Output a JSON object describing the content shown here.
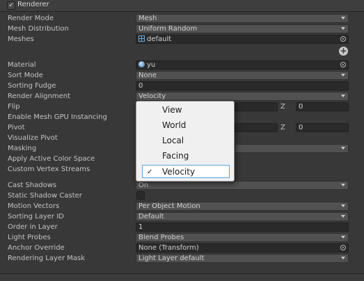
{
  "header": {
    "title": "Renderer",
    "enabled": true
  },
  "rows": {
    "render_mode": {
      "label": "Render Mode",
      "value": "Mesh"
    },
    "mesh_distribution": {
      "label": "Mesh Distribution",
      "value": "Uniform Random"
    },
    "meshes": {
      "label": "Meshes",
      "value": "default",
      "icon": "mesh-icon"
    },
    "material": {
      "label": "Material",
      "value": "yu",
      "icon": "material-icon"
    },
    "sort_mode": {
      "label": "Sort Mode",
      "value": "None"
    },
    "sorting_fudge": {
      "label": "Sorting Fudge",
      "value": "0"
    },
    "render_alignment": {
      "label": "Render Alignment",
      "value": "Velocity"
    },
    "flip": {
      "label": "Flip",
      "z_label": "Z",
      "z_value": "0"
    },
    "enable_mesh_gpu": {
      "label": "Enable Mesh GPU Instancing"
    },
    "pivot": {
      "label": "Pivot",
      "z_label": "Z",
      "z_value": "0"
    },
    "visualize_pivot": {
      "label": "Visualize Pivot"
    },
    "masking": {
      "label": "Masking"
    },
    "apply_active_color": {
      "label": "Apply Active Color Space"
    },
    "custom_vertex": {
      "label": "Custom Vertex Streams"
    },
    "cast_shadows": {
      "label": "Cast Shadows",
      "value": "On"
    },
    "static_shadow": {
      "label": "Static Shadow Caster"
    },
    "motion_vectors": {
      "label": "Motion Vectors",
      "value": "Per Object Motion"
    },
    "sorting_layer": {
      "label": "Sorting Layer ID",
      "value": "Default"
    },
    "order_in_layer": {
      "label": "Order in Layer",
      "value": "1"
    },
    "light_probes": {
      "label": "Light Probes",
      "value": "Blend Probes"
    },
    "anchor_override": {
      "label": "Anchor Override",
      "value": "None (Transform)"
    },
    "rendering_layer": {
      "label": "Rendering Layer Mask",
      "value": "Light Layer default"
    }
  },
  "popup": {
    "options": [
      "View",
      "World",
      "Local",
      "Facing",
      "Velocity"
    ],
    "selected": "Velocity",
    "checkmark": "✓"
  }
}
